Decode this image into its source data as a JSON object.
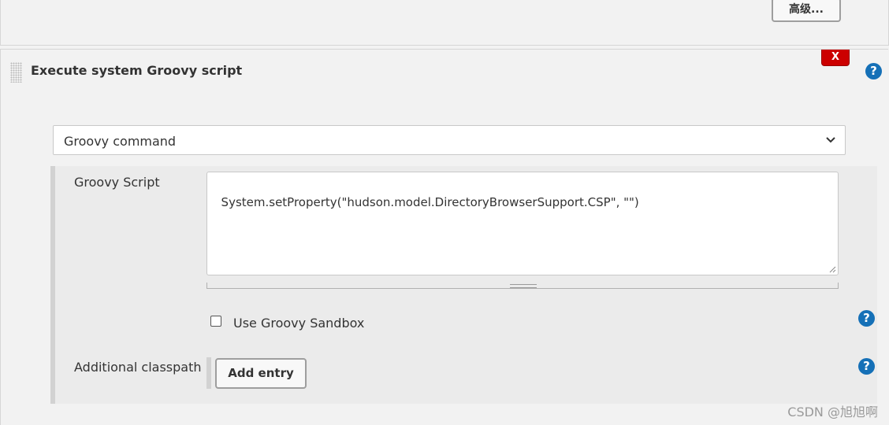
{
  "top_section": {
    "advanced_button_label": "高级..."
  },
  "build_step": {
    "title": "Execute system Groovy script",
    "delete_label": "X",
    "help_symbol": "?"
  },
  "command_select": {
    "selected": "Groovy command"
  },
  "groovy_script": {
    "label": "Groovy Script",
    "value": "System.setProperty(\"hudson.model.DirectoryBrowserSupport.CSP\", \"\")"
  },
  "sandbox": {
    "label": "Use Groovy Sandbox",
    "checked": false
  },
  "classpath": {
    "label": "Additional classpath",
    "add_entry_label": "Add entry"
  },
  "watermark": "CSDN @旭旭啊",
  "colors": {
    "accent_help": "#1570b7",
    "delete_red": "#cc0000",
    "background": "#f2f2f2"
  },
  "icons": {
    "help": "help-icon",
    "select_arrow": "chevron-down-icon",
    "drag": "drag-handle-icon",
    "resize": "resize-corner-icon"
  }
}
